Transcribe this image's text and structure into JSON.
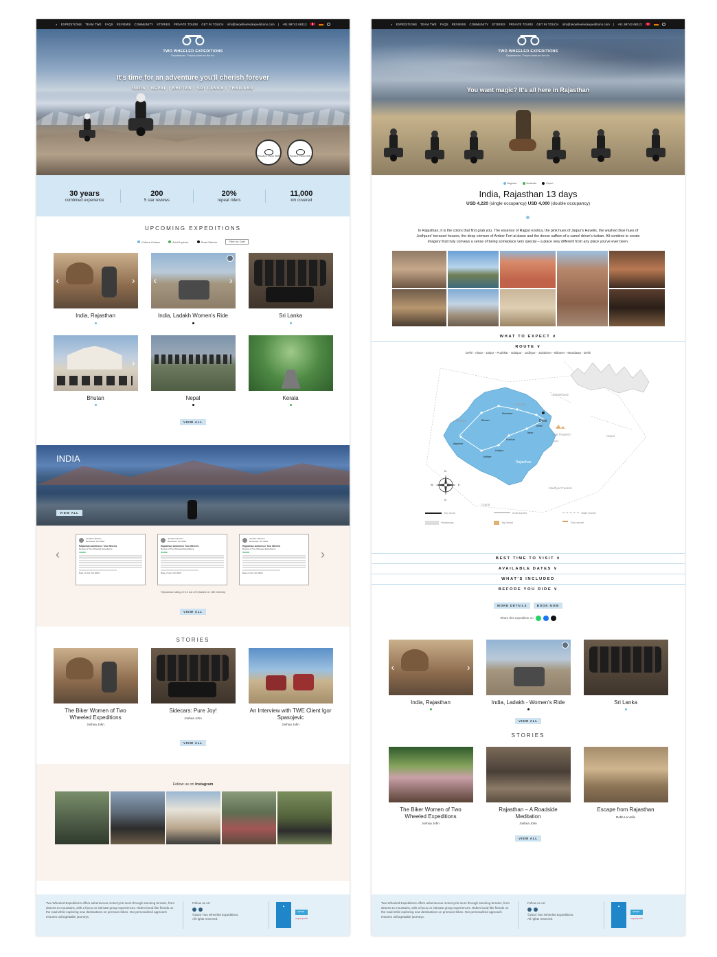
{
  "nav": {
    "items": [
      "EXPEDITIONS",
      "TEAM TWE",
      "FAQs",
      "REVIEWS",
      "COMMUNITY",
      "STORIES",
      "PRIVATE TOURS",
      "GET IN TOUCH"
    ],
    "email": "info@twowheeledexpeditions.com",
    "phone": "+91 99743 66113"
  },
  "brand": {
    "name": "TWO WHEELED EXPEDITIONS",
    "tagline": "Experiences. They're what we live for."
  },
  "left": {
    "hero_title": "It's time for an adventure you'll cherish forever",
    "hero_sub": "INDIA | NEPAL | BHUTAN | SRI LANKA | THAILAND",
    "awards": [
      "Travellers' Choice 2020",
      "Travellers' Choice 2021"
    ],
    "stats": [
      {
        "value": "30 years",
        "label": "combined experience"
      },
      {
        "value": "200",
        "label": "5 star reviews"
      },
      {
        "value": "20%",
        "label": "repeat riders"
      },
      {
        "value": "11,000",
        "label": "km covered"
      }
    ],
    "upcoming_title": "UPCOMING EXPEDITIONS",
    "legend": [
      "Culture Cruiser",
      "Avid Explorer",
      "Road Warrior"
    ],
    "filter_label": "Filter by: Date",
    "expeditions": [
      "India, Rajasthan",
      "India, Ladakh Women's Ride",
      "Sri Lanka",
      "Bhutan",
      "Nepal",
      "Kerala"
    ],
    "view_all": "VIEW ALL",
    "country": "INDIA",
    "reviews": [
      {
        "user": "Jennifer Harrison",
        "date": "Reviewed: Oct 2020",
        "title": "Rajasthan Ambience Two Wheels",
        "sub": "Review of Two Wheeled Expeditions",
        "stars": "●●●●●",
        "visit": "Date of visit: Oct 2020"
      },
      {
        "user": "Jennifer Harrison",
        "date": "Reviewed: Oct 2020",
        "title": "Rajasthan Ambience Two Wheels",
        "sub": "Review of Two Wheeled Expeditions",
        "stars": "●●●●●",
        "visit": "Date of visit: Oct 2020"
      },
      {
        "user": "Jennifer Harrison",
        "date": "Reviewed: Oct 2020",
        "title": "Rajasthan Ambience Two Wheels",
        "sub": "Review of Two Wheeled Expeditions",
        "stars": "●●●●●",
        "visit": "Date of visit: Oct 2020"
      }
    ],
    "reviews_note": "TripAdvisor rating of 5.0 out of 5 (based on 150 reviews)",
    "stories_title": "STORIES",
    "stories": [
      {
        "title": "The Biker Women of Two Wheeled Expeditions",
        "author": "Joshua John"
      },
      {
        "title": "Sidecars: Pure Joy!",
        "author": "Joshua John"
      },
      {
        "title": "An Interview with TWE Client Igor Spasojevic",
        "author": "Joshua John"
      }
    ],
    "instagram_prefix": "Follow us on",
    "instagram": "Instagram"
  },
  "footer": {
    "about": "Two Wheeled Expeditions offers adventurous motorcycle tours through stunning terrains, from deserts to mountains, with a focus on intimate group experiences. Riders bond like friends on the road while exploring new destinations on premium bikes. Our personalized approach ensures unforgettable journeys.",
    "follow": "Follow us on:",
    "copyright": "©2024 Two Wheeled Expeditions.",
    "rights": "All rights reserved.",
    "badge_school": "school",
    "badge_youth": "nepal youth"
  },
  "right": {
    "hero_title": "You want magic? It's all here in Rajasthan",
    "difficulty": [
      "Beginner",
      "Moderate",
      "Expert"
    ],
    "tour_title": "India, Rajasthan 13 days",
    "price_single": "USD 4,220",
    "price_single_note": "(single occupancy)",
    "price_double": "USD 4,000",
    "price_double_note": "(double occupancy)",
    "description": "In Rajasthan, it is the colors that first grab you. The essence of Rajput exotica, the pink hues of Jaipur's Havelis, the washed blue hues of Jodhpurs' terraced houses, the deep crimson of Amber Fort at dawn and the dense saffron of a camel driver's turban. All combine to create imagery that truly conveys a sense of being someplace very special – a place very different from any place you've ever been.",
    "what_to_expect": "WHAT TO EXPECT ∨",
    "route": "ROUTE ∨",
    "route_line": "Delhi - Alwar - Jaipur - Pushkar - Udaipur - Jodhpur - Jaisalmer - Bikaner - Mandawa - Delhi",
    "map_labels": {
      "pakistan": "Pakistan",
      "haryana": "Haryana",
      "uttarakhand": "Uttarakhand",
      "delhi": "Delhi",
      "up": "Uttar Pradesh",
      "nepal": "Nepal",
      "rajasthan": "Rajasthan",
      "mp": "Madhya Pradesh",
      "gujarat": "Gujrat",
      "agra": "Agra",
      "bikaner": "Bikaner",
      "mandawa": "Mandawa",
      "jaisalmer": "Jaisalmer",
      "jodhpur": "Jodhpur",
      "jaipur": "Jaipur",
      "alwar": "Alwar",
      "pushkar": "Pushkar",
      "udaipur": "Udaipur"
    },
    "compass": {
      "n": "N",
      "s": "S",
      "e": "E",
      "w": "W"
    },
    "map_legend": [
      "Trip route",
      "India border",
      "State border",
      "Himalayas",
      "Taj Mahal",
      "Thar desert"
    ],
    "best_time": "BEST TIME TO VISIT ∨",
    "dates": "AVAILABLE DATES ∨",
    "included": "WHAT'S INCLUDED",
    "before": "BEFORE YOU RIDE ∨",
    "more_details": "MORE DETAILS",
    "book_now": "BOOK NOW",
    "share": "Share this expedition on",
    "related": [
      "India, Rajasthan",
      "India, Ladakh - Women's Ride",
      "Sri Lanka"
    ],
    "view_all": "VIEW ALL",
    "stories_title": "STORIES",
    "stories": [
      {
        "title": "The Biker Women of Two Wheeled Expeditions",
        "author": "Joshua John"
      },
      {
        "title": "Rajasthan – A Roadside Meditation",
        "author": "Joshua John"
      },
      {
        "title": "Escape from Rajasthan",
        "author": "Robb La Velle"
      }
    ]
  },
  "colors": {
    "accent": "#cde3f2",
    "culture": "#6fb7e0",
    "explorer": "#4caf50",
    "warrior": "#111111"
  }
}
